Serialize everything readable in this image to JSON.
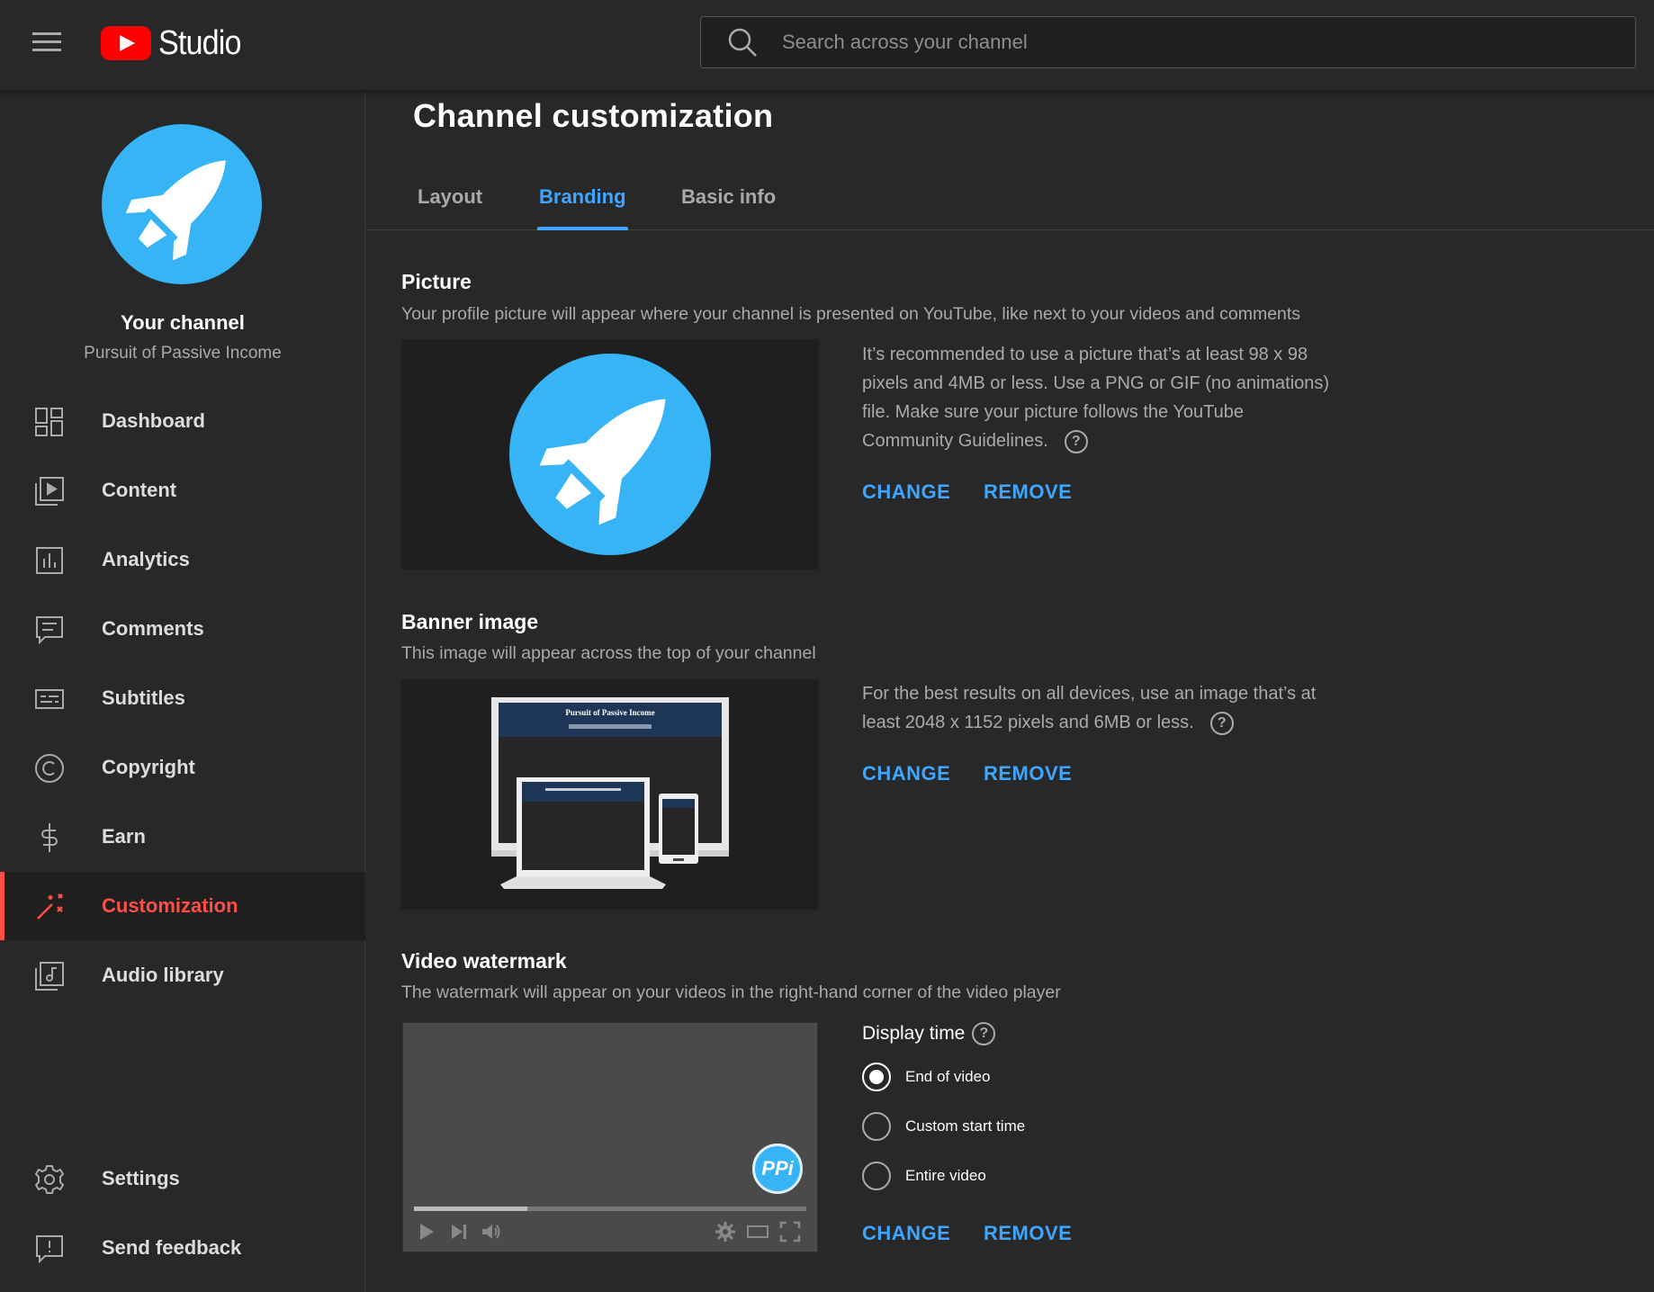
{
  "app": {
    "logo_text": "Studio"
  },
  "search": {
    "placeholder": "Search across your channel"
  },
  "sidebar": {
    "channel_title": "Your channel",
    "channel_name": "Pursuit of Passive Income",
    "items": [
      {
        "label": "Dashboard",
        "icon": "dashboard-icon"
      },
      {
        "label": "Content",
        "icon": "content-icon"
      },
      {
        "label": "Analytics",
        "icon": "analytics-icon"
      },
      {
        "label": "Comments",
        "icon": "comments-icon"
      },
      {
        "label": "Subtitles",
        "icon": "subtitles-icon"
      },
      {
        "label": "Copyright",
        "icon": "copyright-icon"
      },
      {
        "label": "Earn",
        "icon": "earn-icon"
      },
      {
        "label": "Customization",
        "icon": "customization-icon",
        "active": true
      },
      {
        "label": "Audio library",
        "icon": "audio-library-icon"
      }
    ],
    "bottom_items": [
      {
        "label": "Settings",
        "icon": "gear-icon"
      },
      {
        "label": "Send feedback",
        "icon": "feedback-icon"
      }
    ]
  },
  "main": {
    "title": "Channel customization",
    "tabs": [
      {
        "label": "Layout"
      },
      {
        "label": "Branding",
        "active": true
      },
      {
        "label": "Basic info"
      }
    ],
    "picture": {
      "title": "Picture",
      "description": "Your profile picture will appear where your channel is presented on YouTube, like next to your videos and comments",
      "info": "It’s recommended to use a picture that’s at least 98 x 98 pixels and 4MB or less. Use a PNG or GIF (no animations) file. Make sure your picture follows the YouTube Community Guidelines.",
      "change": "CHANGE",
      "remove": "REMOVE"
    },
    "banner": {
      "title": "Banner image",
      "description": "This image will appear across the top of your channel",
      "info": "For the best results on all devices, use an image that’s at least 2048 x 1152 pixels and 6MB or less.",
      "banner_text": "Pursuit of Passive Income",
      "change": "CHANGE",
      "remove": "REMOVE"
    },
    "watermark": {
      "title": "Video watermark",
      "description": "The watermark will appear on your videos in the right-hand corner of the video player",
      "watermark_text": "PPi",
      "progress": 0.29,
      "display_time_label": "Display time",
      "options": [
        {
          "label": "End of video",
          "checked": true
        },
        {
          "label": "Custom start time",
          "checked": false
        },
        {
          "label": "Entire video",
          "checked": false
        }
      ],
      "change": "CHANGE",
      "remove": "REMOVE"
    }
  },
  "colors": {
    "accent": "#3ea6ff",
    "active_nav": "#ff4e45",
    "avatar_bg": "#36b4f6",
    "background": "#282828"
  }
}
